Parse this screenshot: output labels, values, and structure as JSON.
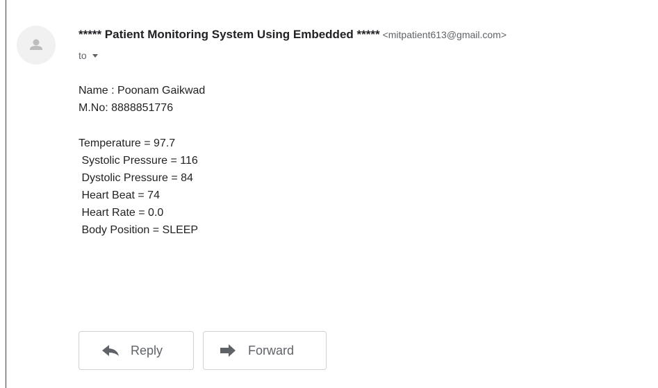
{
  "message": {
    "subject_sender": "***** Patient Monitoring System Using Embedded *****",
    "sender_email": "<mitpatient613@gmail.com>",
    "to_label": "to",
    "body": {
      "name_line": "Name : Poonam Gaikwad",
      "mobile_line": "M.No: 8888851776",
      "readings": [
        "Temperature = 97.7",
        " Systolic Pressure = 116",
        " Dystolic Pressure = 84",
        " Heart Beat = 74",
        " Heart Rate = 0.0",
        " Body Position = SLEEP"
      ]
    }
  },
  "actions": {
    "reply_label": "Reply",
    "forward_label": "Forward"
  },
  "icons": {
    "avatar": "person-icon",
    "to_caret": "caret-down-icon",
    "reply": "reply-arrow-icon",
    "forward": "forward-arrow-icon"
  },
  "colors": {
    "text": "#222222",
    "muted": "#5f6368",
    "avatar_bg": "#f1f1f1",
    "avatar_fg": "#bdbdbd",
    "button_border": "#d2d2d2"
  }
}
